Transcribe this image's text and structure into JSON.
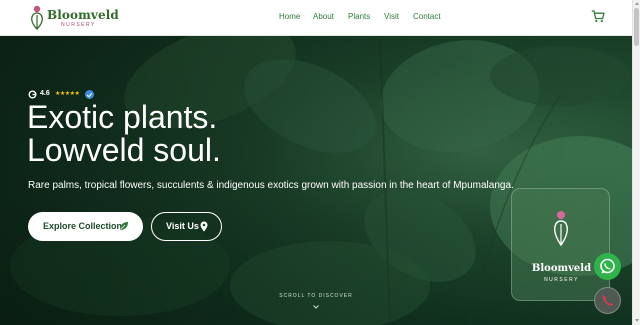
{
  "brand": {
    "name": "Bloomveld",
    "tagline": "NURSERY"
  },
  "nav": {
    "items": [
      "Home",
      "About",
      "Plants",
      "Visit",
      "Contact"
    ]
  },
  "header": {
    "cart_icon": "cart-icon"
  },
  "hero": {
    "rating": {
      "value": "4.6",
      "stars": "★★★★★",
      "rating_stars": 4.6
    },
    "headline_line1": "Exotic plants.",
    "headline_line2": "Lowveld soul.",
    "subtext": "Rare palms, tropical flowers, succulents & indigenous exotics grown with passion in the heart of Mpumalanga.",
    "explore_label": "Explore Collection",
    "visit_label": "Visit Us",
    "scroll_hint": "SCROLL TO DISCOVER"
  },
  "card": {
    "name": "Bloomveld",
    "sub": "NURSERY"
  },
  "floating": {
    "whatsapp_icon": "whatsapp-icon",
    "call_icon": "phone-icon"
  },
  "colors": {
    "brand_green": "#2f6b2a",
    "nav_green": "#2e7d3a",
    "accent_pink": "#b14a6e",
    "whatsapp": "#2fb34a"
  }
}
